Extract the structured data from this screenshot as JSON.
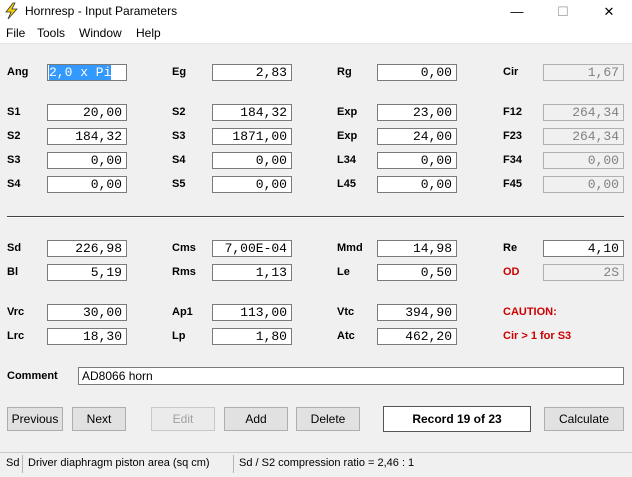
{
  "window": {
    "title": "Hornresp - Input Parameters",
    "minimize": "—",
    "maximize": "☐",
    "close": "✕"
  },
  "menu": [
    "File",
    "Tools",
    "Window",
    "Help"
  ],
  "params": {
    "ang": {
      "label": "Ang",
      "value": "2,0 x Pi"
    },
    "eg": {
      "label": "Eg",
      "value": "2,83"
    },
    "rg": {
      "label": "Rg",
      "value": "0,00"
    },
    "cir": {
      "label": "Cir",
      "value": "1,67"
    },
    "s1": {
      "label": "S1",
      "value": "20,00"
    },
    "s2a": {
      "label": "S2",
      "value": "184,32"
    },
    "exp1": {
      "label": "Exp",
      "value": "23,00"
    },
    "f12": {
      "label": "F12",
      "value": "264,34"
    },
    "s2b": {
      "label": "S2",
      "value": "184,32"
    },
    "s3a": {
      "label": "S3",
      "value": "1871,00"
    },
    "exp2": {
      "label": "Exp",
      "value": "24,00"
    },
    "f23": {
      "label": "F23",
      "value": "264,34"
    },
    "s3b": {
      "label": "S3",
      "value": "0,00"
    },
    "s4a": {
      "label": "S4",
      "value": "0,00"
    },
    "l34": {
      "label": "L34",
      "value": "0,00"
    },
    "f34": {
      "label": "F34",
      "value": "0,00"
    },
    "s4b": {
      "label": "S4",
      "value": "0,00"
    },
    "s5": {
      "label": "S5",
      "value": "0,00"
    },
    "l45": {
      "label": "L45",
      "value": "0,00"
    },
    "f45": {
      "label": "F45",
      "value": "0,00"
    },
    "sd": {
      "label": "Sd",
      "value": "226,98"
    },
    "cms": {
      "label": "Cms",
      "value": "7,00E-04"
    },
    "mmd": {
      "label": "Mmd",
      "value": "14,98"
    },
    "re": {
      "label": "Re",
      "value": "4,10"
    },
    "bl": {
      "label": "Bl",
      "value": "5,19"
    },
    "rms": {
      "label": "Rms",
      "value": "1,13"
    },
    "le": {
      "label": "Le",
      "value": "0,50"
    },
    "od": {
      "label": "OD",
      "value": "2S"
    },
    "vrc": {
      "label": "Vrc",
      "value": "30,00"
    },
    "ap1": {
      "label": "Ap1",
      "value": "113,00"
    },
    "vtc": {
      "label": "Vtc",
      "value": "394,90"
    },
    "lrc": {
      "label": "Lrc",
      "value": "18,30"
    },
    "lp": {
      "label": "Lp",
      "value": "1,80"
    },
    "atc": {
      "label": "Atc",
      "value": "462,20"
    }
  },
  "caution": {
    "title": "CAUTION:",
    "message": "Cir > 1 for S3"
  },
  "comment": {
    "label": "Comment",
    "value": "AD8066 horn"
  },
  "buttons": {
    "previous": "Previous",
    "next": "Next",
    "edit": "Edit",
    "add": "Add",
    "delete": "Delete",
    "calculate": "Calculate"
  },
  "record": "Record 19 of 23",
  "status": {
    "field": "Sd",
    "description": "Driver diaphragm piston area  (sq cm)",
    "ratio": "Sd / S2 compression ratio = 2,46 : 1"
  },
  "colors": {
    "warning": "#cc0000",
    "selection": "#3399ff"
  }
}
